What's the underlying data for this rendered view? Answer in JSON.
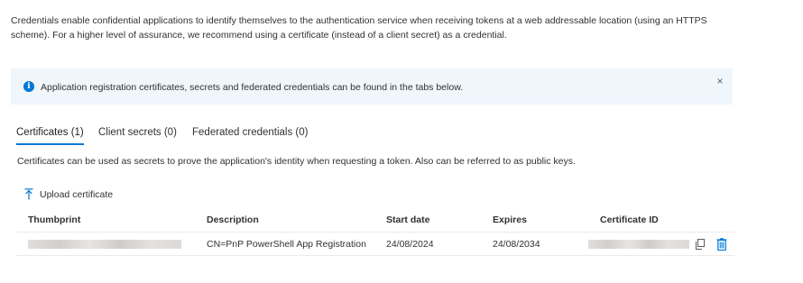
{
  "intro": {
    "text_line1": "Credentials enable confidential applications to identify themselves to the authentication service when receiving tokens at a web addressable location (using an HTTPS",
    "text_line2": "scheme). For a higher level of assurance, we recommend using a certificate (instead of a client secret) as a credential."
  },
  "banner": {
    "text": "Application registration certificates, secrets and federated credentials can be found in the tabs below.",
    "icon": "info-icon",
    "close_icon": "close-icon",
    "close_glyph": "×",
    "info_glyph": "i"
  },
  "tabs": [
    {
      "label": "Certificates (1)",
      "active": true
    },
    {
      "label": "Client secrets (0)",
      "active": false
    },
    {
      "label": "Federated credentials (0)",
      "active": false
    }
  ],
  "certificates": {
    "description": "Certificates can be used as secrets to prove the application's identity when requesting a token. Also can be referred to as public keys.",
    "upload_label": "Upload certificate",
    "columns": [
      "Thumbprint",
      "Description",
      "Start date",
      "Expires",
      "Certificate ID"
    ],
    "rows": [
      {
        "thumbprint": "",
        "description": "CN=PnP PowerShell App Registration",
        "start_date": "24/08/2024",
        "expires": "24/08/2034",
        "certificate_id": ""
      }
    ]
  },
  "colors": {
    "accent": "#0078d4",
    "banner_bg": "#eff6fc",
    "text": "#323130",
    "divider": "#edebe9"
  }
}
